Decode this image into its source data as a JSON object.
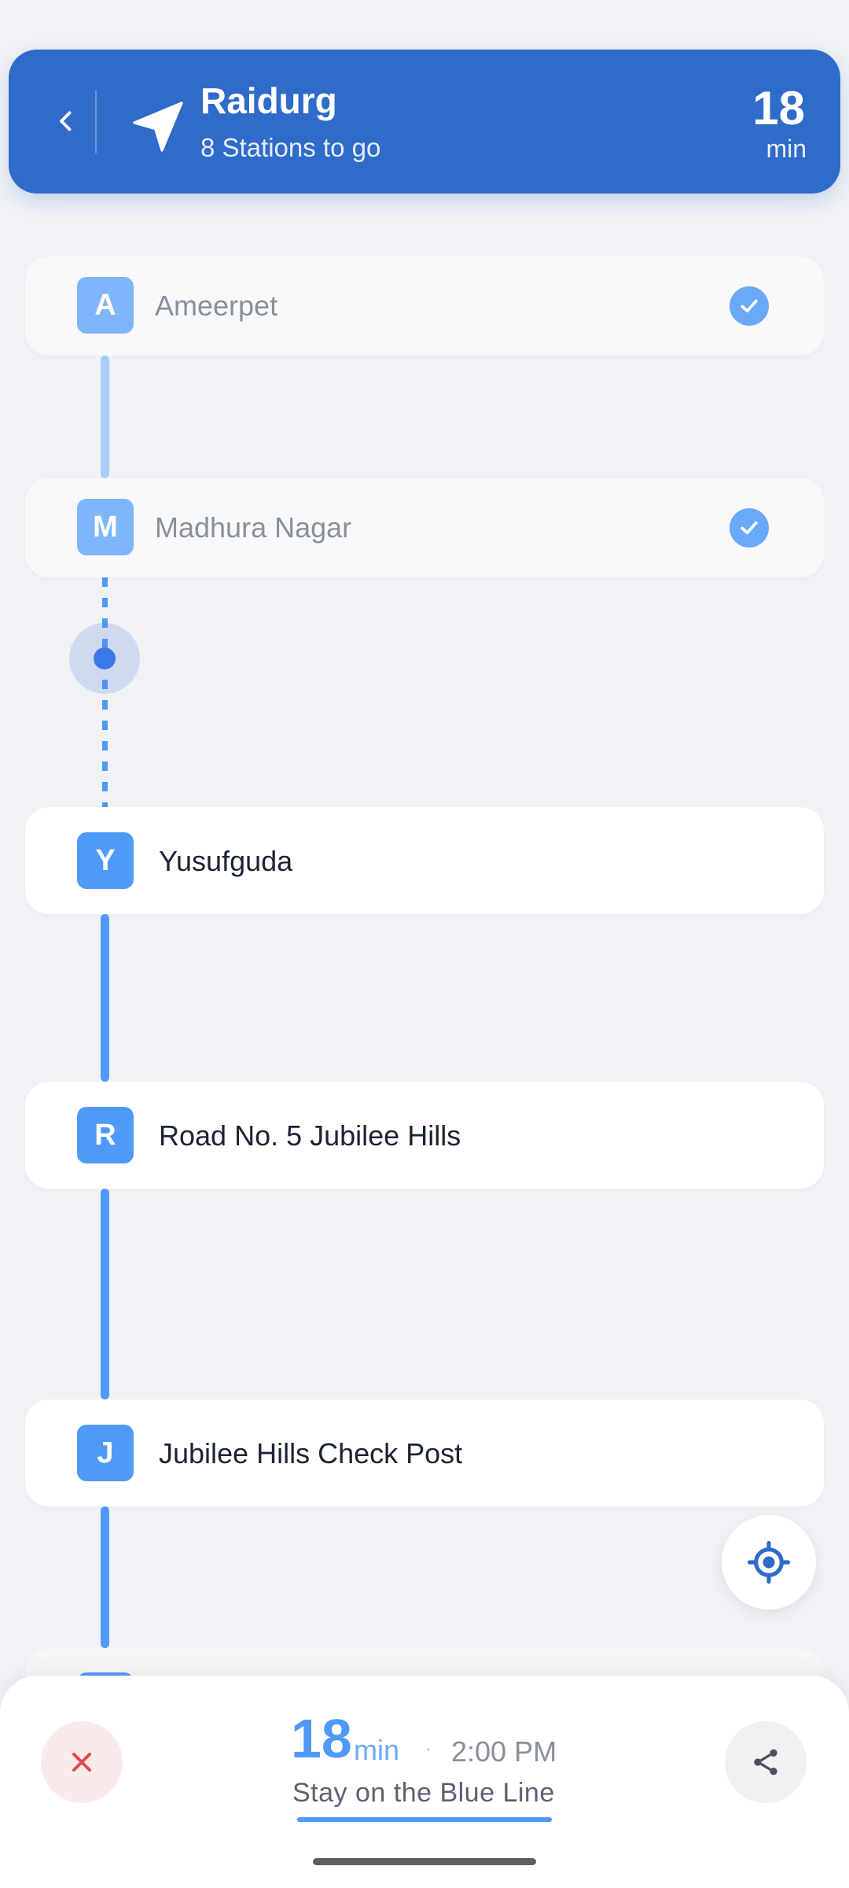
{
  "header": {
    "destination": "Raidurg",
    "subtitle": "8 Stations to go",
    "eta_value": "18",
    "eta_unit": "min"
  },
  "stations": [
    {
      "letter": "A",
      "name": "Ameerpet",
      "status": "passed"
    },
    {
      "letter": "M",
      "name": "Madhura Nagar",
      "status": "passed"
    },
    {
      "letter": "Y",
      "name": "Yusufguda",
      "status": "upcoming"
    },
    {
      "letter": "R",
      "name": "Road No. 5 Jubilee Hills",
      "status": "upcoming"
    },
    {
      "letter": "J",
      "name": "Jubilee Hills Check Post",
      "status": "upcoming"
    }
  ],
  "bottom": {
    "eta_value": "18",
    "eta_unit": "min",
    "separator": "·",
    "arrival_time": "2:00 PM",
    "hint": "Stay on the Blue Line"
  },
  "colors": {
    "header_bg": "#2f6bc8",
    "line_blue": "#4f9af7",
    "passed_check": "#6aa8f8",
    "close_accent": "#e04a4a"
  },
  "icons": {
    "back": "chevron-left-icon",
    "navigation": "navigation-arrow-icon",
    "check": "check-icon",
    "locate": "crosshair-locate-icon",
    "close": "close-icon",
    "share": "share-icon"
  }
}
